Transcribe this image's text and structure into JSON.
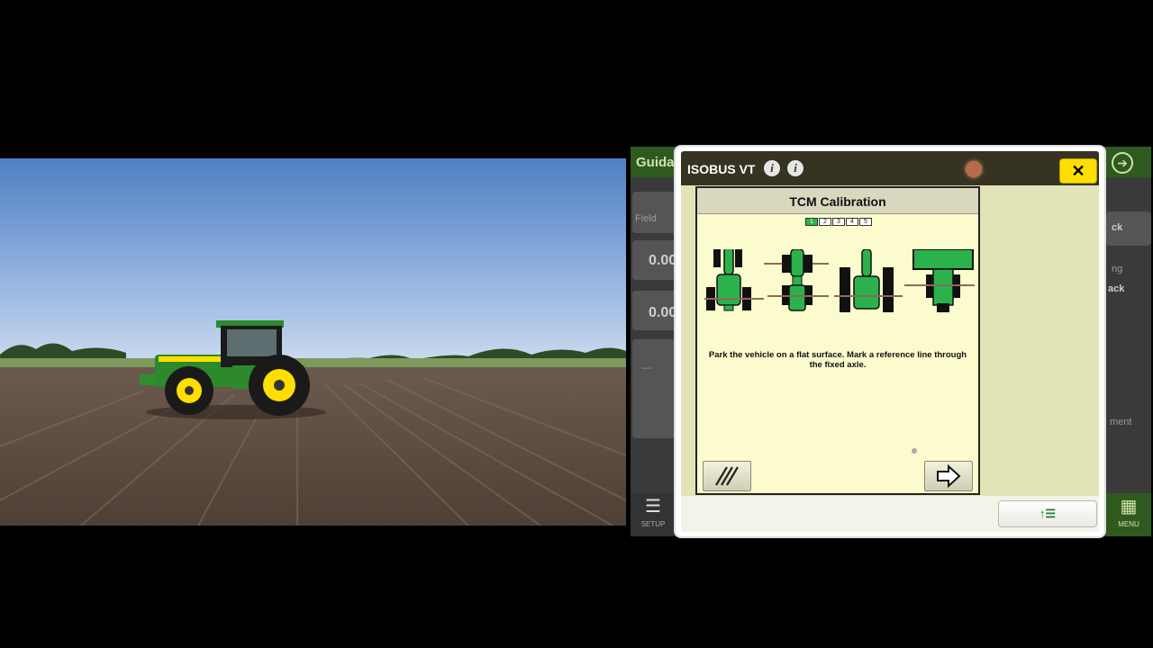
{
  "dialog": {
    "title": "ISOBUS VT",
    "info_glyph_1": "i",
    "info_glyph_2": "i",
    "close_glyph": "✕",
    "bottom_button_label": "↑☰"
  },
  "vt_screen": {
    "title": "TCM Calibration",
    "steps": [
      "1",
      "2",
      "3",
      "4",
      "5"
    ],
    "active_step": 1,
    "instruction": "Park the vehicle on a flat surface.  Mark a reference line through the fixed axle.",
    "icons": [
      "tractor-icon",
      "articulated-tractor-icon",
      "track-tractor-icon",
      "sprayer-icon"
    ],
    "cancel_icon": "hatch-icon",
    "next_icon": "arrow-right-icon"
  },
  "background_app": {
    "title": "Guida",
    "field_label": "Field",
    "value_1": "0.00",
    "value_2": "0.00",
    "right_text_1": "ck",
    "right_text_2": "ng",
    "right_text_3": "ack",
    "right_text_4": "ment",
    "setup_label": "SETUP",
    "menu_label": "MENU",
    "dashes": "---"
  },
  "colors": {
    "jd_green": "#2bb24c",
    "jd_yellow": "#ffde00",
    "vt_background": "#fbfbcd",
    "header_dark": "#363322"
  }
}
